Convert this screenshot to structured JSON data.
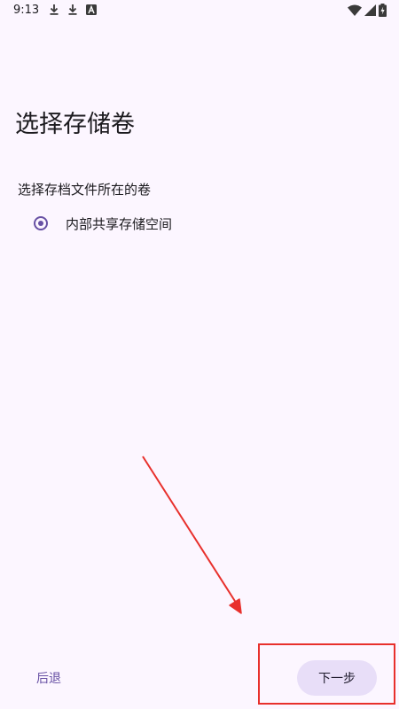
{
  "status_bar": {
    "time": "9:13",
    "left_icons": [
      "download-icon",
      "download-icon",
      "font-a-icon"
    ],
    "right_icons": [
      "wifi-icon",
      "cellular-signal-icon",
      "battery-charging-icon"
    ]
  },
  "page": {
    "title": "选择存储卷",
    "section_label": "选择存档文件所在的卷",
    "options": [
      {
        "label": "内部共享存储空间",
        "selected": true
      }
    ]
  },
  "bottom_bar": {
    "back_label": "后退",
    "next_label": "下一步"
  },
  "colors": {
    "background": "#fcf6ff",
    "accent": "#6750a4",
    "next_button_bg": "#e8def8",
    "annotation": "#e8302c"
  }
}
